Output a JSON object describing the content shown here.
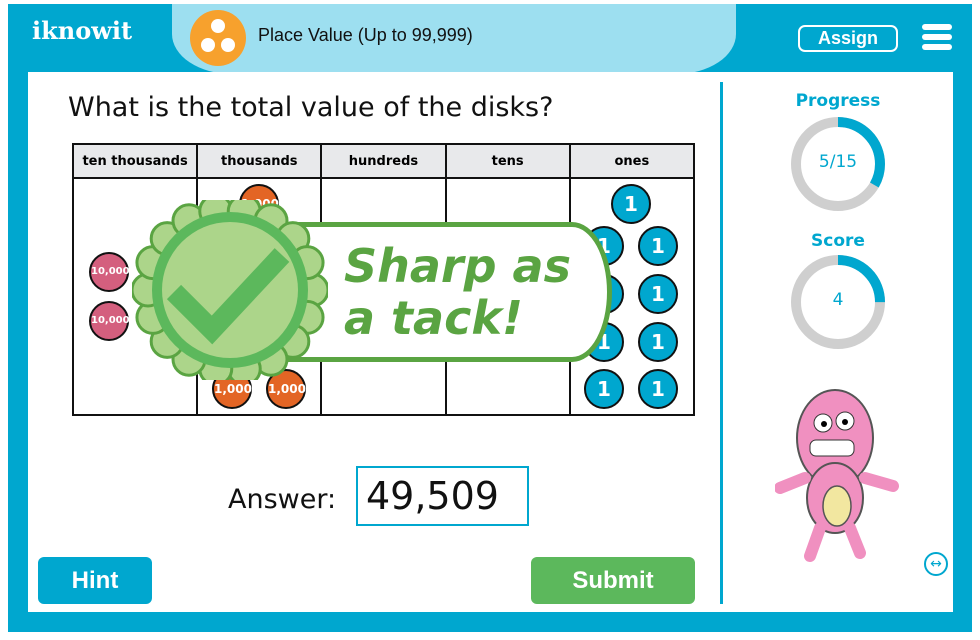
{
  "header": {
    "logo": "iknowit",
    "lesson_title": "Place Value (Up to 99,999)",
    "lesson_icon": "three-dots-icon",
    "assign_label": "Assign",
    "menu_icon": "hamburger-icon"
  },
  "question": {
    "text": "What is the total value of the disks?",
    "columns": [
      "ten thousands",
      "thousands",
      "hundreds",
      "tens",
      "ones"
    ],
    "disks": {
      "ten_thousands": "10,000",
      "thousands": "1,000",
      "ones": "1"
    }
  },
  "feedback": {
    "line1": "Sharp as",
    "line2": "a tack!",
    "icon": "checkmark-badge-icon"
  },
  "answer": {
    "label": "Answer:",
    "value": "49,509"
  },
  "buttons": {
    "hint": "Hint",
    "submit": "Submit"
  },
  "sidebar": {
    "progress_label": "Progress",
    "progress_value": "5/15",
    "progress_fraction": 0.333,
    "score_label": "Score",
    "score_value": "4",
    "score_fraction": 0.25
  },
  "colors": {
    "brand": "#00a7cf",
    "success": "#5cb85c",
    "badge_green": "#5aa442"
  }
}
